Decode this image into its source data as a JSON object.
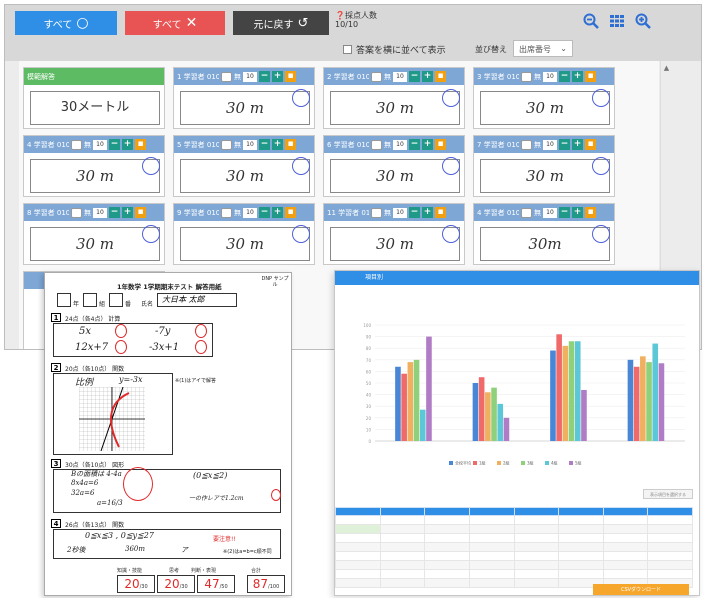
{
  "toolbar": {
    "all_correct_label": "すべて",
    "all_correct_icon": "○",
    "all_wrong_label": "すべて",
    "all_wrong_icon": "✕",
    "undo_label": "元に戻す",
    "undo_icon": "↺",
    "count_label": "採点人数",
    "count_value": "10/10",
    "show_side_by_side": "答案を横に並べて表示",
    "sort_label": "並び替え",
    "sort_value": "出席番号",
    "sort_arrow": "⌄",
    "zoom_out_icon": "zoom-out-icon",
    "grid_icon": "grid-view-icon",
    "zoom_in_icon": "zoom-in-icon"
  },
  "cards": [
    {
      "header": "模範解答",
      "answer": "30メートル",
      "model": true
    },
    {
      "header": "1 学習者 010…",
      "answer": "30 m",
      "score": "10"
    },
    {
      "header": "2 学習者 010…",
      "answer": "30 m",
      "score": "10"
    },
    {
      "header": "3 学習者 010…",
      "answer": "30 m",
      "score": "10"
    },
    {
      "header": "4 学習者 010…",
      "answer": "30 m",
      "score": "10"
    },
    {
      "header": "5 学習者 010…",
      "answer": "30 m",
      "score": "10"
    },
    {
      "header": "6 学習者 010…",
      "answer": "30 m",
      "score": "10"
    },
    {
      "header": "7 学習者 010…",
      "answer": "30 m",
      "score": "10"
    },
    {
      "header": "8 学習者 010…",
      "answer": "30 m",
      "score": "10"
    },
    {
      "header": "9 学習者 010…",
      "answer": "30 m",
      "score": "10"
    },
    {
      "header": "11 学習者 01…",
      "answer": "30 m",
      "score": "10"
    },
    {
      "header": "4 学習者 010…",
      "answer": "30m",
      "score": "10"
    }
  ],
  "card_check_label": "無",
  "sheet": {
    "title": "1年数学 1学期期末テスト 解答用紙",
    "corner": "DNP サンプル",
    "year_label": "年",
    "class_label": "組",
    "number_label": "番",
    "name_label": "氏名",
    "name_value": "大日本 太郎",
    "q1": "24点（各4点） 計算",
    "q1_a1": "5x",
    "q1_a2": "-7y",
    "q1_a3": "12x+7",
    "q1_a4": "-3x+1",
    "q2": "20点（各10点） 関数",
    "q2_a1": "比例",
    "q2_a1b": "y=-3x",
    "q2_note": "※(1)はアイで解答",
    "q3": "30点（各10点） 図形",
    "q3_a1": "Bの面積は 4-4a",
    "q3_a2": "8x4a=6",
    "q3_a3": "32a=6",
    "q3_a4": "a=16/3",
    "q3_a5": "(0≦x≦2)",
    "q3_a6": "一の作レアで1.2cm",
    "q4": "26点（各13点） 関数",
    "q4_a1": "0≦x≦3 , 0≦y≦27",
    "q4_note": "要注意!!",
    "q4_a2": "2秒後",
    "q4_a3": "360m",
    "q4_a4": "ア",
    "q4_ref": "※(2)はa=b=c順不同",
    "score_labels": [
      "知識・技能",
      "思考",
      "判断・表現",
      "合計"
    ],
    "scores": [
      "20",
      "20",
      "47",
      "87"
    ],
    "score_max": [
      "/30",
      "/30",
      "/50",
      "/100"
    ]
  },
  "report": {
    "title": "項目別",
    "legend": [
      "全校平均",
      "1組",
      "2組",
      "3組",
      "4組",
      "5組"
    ],
    "export_label": "CSVダウンロード",
    "small_btn": "表示項目を選択する",
    "table_header": [
      "",
      "",
      "",
      "",
      "",
      "",
      "",
      ""
    ],
    "colors": [
      "#4a86d6",
      "#f06a6a",
      "#f0b060",
      "#8fd17a",
      "#5cc7d6",
      "#b07cc6"
    ]
  },
  "chart_data": {
    "type": "bar",
    "categories": [
      "",
      "",
      "",
      ""
    ],
    "series": [
      {
        "values": [
          64,
          50,
          78,
          70
        ]
      },
      {
        "values": [
          58,
          55,
          92,
          64
        ]
      },
      {
        "values": [
          68,
          42,
          82,
          73
        ]
      },
      {
        "values": [
          70,
          46,
          86,
          68
        ]
      },
      {
        "values": [
          27,
          32,
          86,
          84
        ]
      },
      {
        "values": [
          90,
          20,
          44,
          67
        ]
      }
    ],
    "ylim": [
      0,
      100
    ],
    "legend_position": "bottom"
  }
}
